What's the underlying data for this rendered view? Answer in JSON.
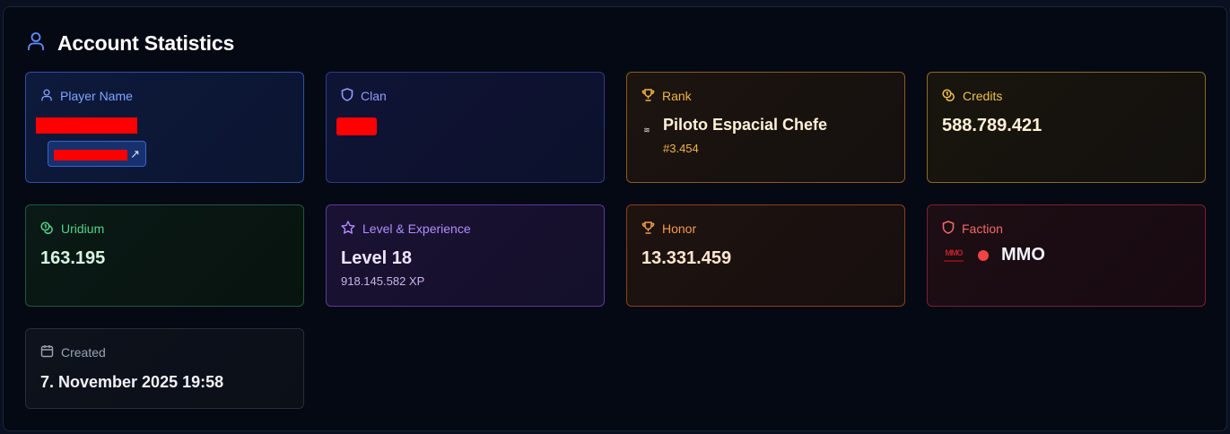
{
  "header": {
    "title": "Account Statistics",
    "icon": "user-icon"
  },
  "cards": {
    "player": {
      "label": "Player Name",
      "icon": "user-icon",
      "link_glyph": "↗"
    },
    "clan": {
      "label": "Clan",
      "icon": "shield-icon"
    },
    "rank": {
      "label": "Rank",
      "icon": "trophy-icon",
      "rank_glyph": "≋",
      "name": "Piloto Espacial Chefe",
      "position": "#3.454"
    },
    "credits": {
      "label": "Credits",
      "icon": "coins-icon",
      "value": "588.789.421"
    },
    "uridium": {
      "label": "Uridium",
      "icon": "coins-icon",
      "value": "163.195"
    },
    "level": {
      "label": "Level & Experience",
      "icon": "star-icon",
      "value": "Level 18",
      "xp": "918.145.582 XP"
    },
    "honor": {
      "label": "Honor",
      "icon": "trophy-icon",
      "value": "13.331.459"
    },
    "faction": {
      "label": "Faction",
      "icon": "shield-icon",
      "logo_text": "MMO",
      "name": "MMO",
      "dot_color": "#ef4444"
    },
    "created": {
      "label": "Created",
      "icon": "calendar-icon",
      "value": "7. November 2025 19:58"
    }
  }
}
